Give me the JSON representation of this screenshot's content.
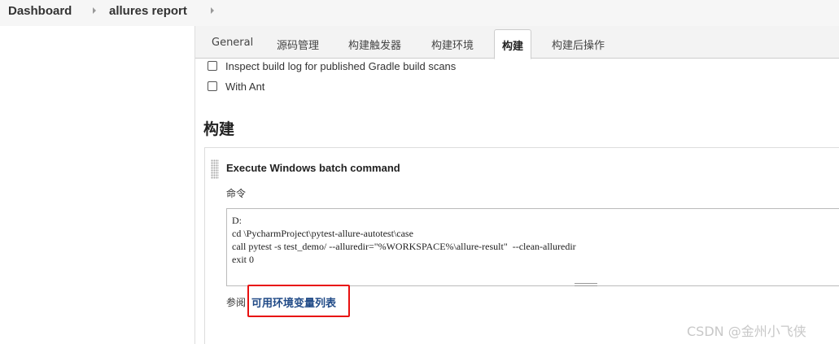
{
  "breadcrumb": {
    "items": [
      {
        "label": "Dashboard"
      },
      {
        "label": "allures report"
      }
    ]
  },
  "tabs": [
    {
      "label": "General",
      "active": false
    },
    {
      "label": "源码管理",
      "active": false
    },
    {
      "label": "构建触发器",
      "active": false
    },
    {
      "label": "构建环境",
      "active": false
    },
    {
      "label": "构建",
      "active": true
    },
    {
      "label": "构建后操作",
      "active": false
    }
  ],
  "options": [
    {
      "label": "Inspect build log for published Gradle build scans",
      "checked": false
    },
    {
      "label": "With Ant",
      "checked": false
    }
  ],
  "build_section": {
    "title": "构建",
    "step": {
      "title": "Execute Windows batch command",
      "command_label": "命令",
      "command_value": "D:\ncd \\PycharmProject\\pytest-allure-autotest\\case\ncall pytest -s test_demo/ --alluredir=\"%WORKSPACE%\\allure-result\"  --clean-alluredir\nexit 0",
      "see_also_label": "参阅",
      "env_link_label": "可用环境变量列表"
    }
  },
  "watermark": "CSDN @金州小飞侠",
  "colors": {
    "highlight": "#e8100f",
    "link": "#204a87",
    "tabbar_bg": "#f3f3f3"
  }
}
